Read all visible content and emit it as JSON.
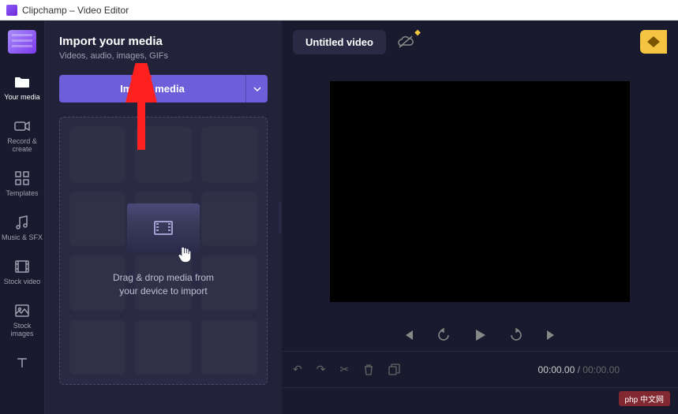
{
  "titlebar": {
    "title": "Clipchamp – Video Editor"
  },
  "sidebar": {
    "items": [
      {
        "label": "Your media",
        "active": true
      },
      {
        "label": "Record & create"
      },
      {
        "label": "Templates"
      },
      {
        "label": "Music & SFX"
      },
      {
        "label": "Stock video"
      },
      {
        "label": "Stock images"
      },
      {
        "label": ""
      }
    ]
  },
  "panel": {
    "title": "Import your media",
    "subtitle": "Videos, audio, images, GIFs",
    "import_button": "Import media",
    "dropzone_line1": "Drag & drop media from",
    "dropzone_line2": "your device to import"
  },
  "topbar": {
    "project_title": "Untitled video"
  },
  "player": {
    "current_time": "00:00.00",
    "total_time": "00:00.00"
  },
  "watermark": "php 中文网"
}
